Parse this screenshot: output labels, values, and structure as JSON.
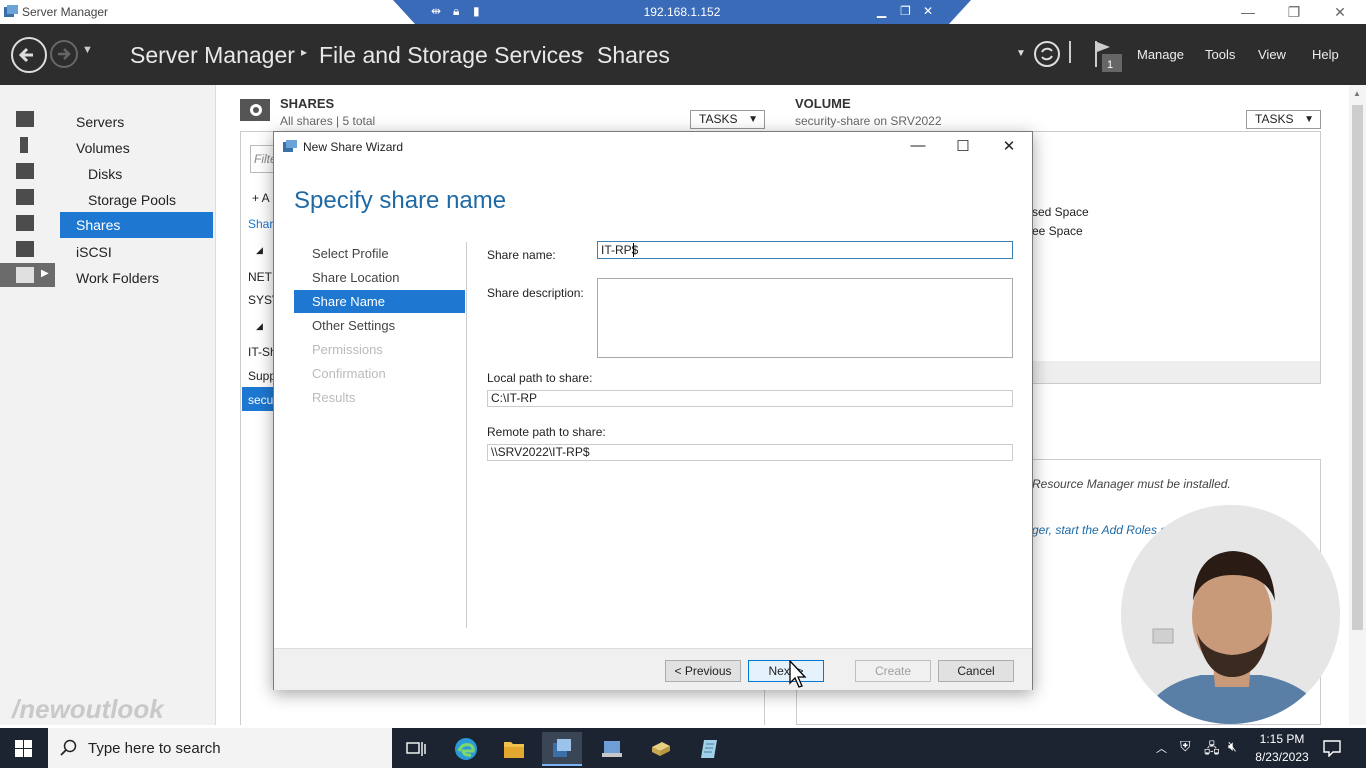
{
  "window": {
    "title": "Server Manager",
    "controls": [
      "—",
      "❐",
      "✕"
    ]
  },
  "rdp": {
    "address": "192.168.1.152"
  },
  "header": {
    "breadcrumb": [
      "Server Manager",
      "File and Storage Services",
      "Shares"
    ],
    "menu": [
      "Manage",
      "Tools",
      "View",
      "Help"
    ],
    "flag_badge": "1"
  },
  "sidebar": {
    "items": [
      {
        "label": "Servers"
      },
      {
        "label": "Volumes"
      },
      {
        "label": "Disks"
      },
      {
        "label": "Storage Pools"
      },
      {
        "label": "Shares"
      },
      {
        "label": "iSCSI"
      },
      {
        "label": "Work Folders"
      }
    ]
  },
  "shares_panel": {
    "title": "SHARES",
    "subtitle": "All shares | 5 total",
    "tasks": "TASKS",
    "filter_placeholder": "Filter",
    "add_text": "+ A",
    "col_fragment": "Share",
    "rows": [
      "NETL",
      "SYSV",
      "IT-Sh",
      "Supp",
      "secu"
    ]
  },
  "volume_panel": {
    "title": "VOLUME",
    "subtitle": "security-share on SRV2022",
    "tasks": "TASKS",
    "used_space": "sed Space",
    "free_space": "ee Space",
    "note1": "Resource Manager must be installed.",
    "note2": "ger, start the Add Roles c"
  },
  "wizard": {
    "title": "New Share Wizard",
    "heading": "Specify share name",
    "steps": [
      {
        "label": "Select Profile",
        "state": "normal"
      },
      {
        "label": "Share Location",
        "state": "normal"
      },
      {
        "label": "Share Name",
        "state": "active"
      },
      {
        "label": "Other Settings",
        "state": "normal"
      },
      {
        "label": "Permissions",
        "state": "disabled"
      },
      {
        "label": "Confirmation",
        "state": "disabled"
      },
      {
        "label": "Results",
        "state": "disabled"
      }
    ],
    "fields": {
      "share_name_label": "Share name:",
      "share_name_value": "IT-RP$",
      "share_description_label": "Share description:",
      "share_description_value": "",
      "local_path_label": "Local path to share:",
      "local_path_value": "C:\\IT-RP",
      "remote_path_label": "Remote path to share:",
      "remote_path_value": "\\\\SRV2022\\IT-RP$"
    },
    "buttons": {
      "previous": "< Previous",
      "next": "Next >",
      "create": "Create",
      "cancel": "Cancel"
    }
  },
  "watermark": "/newoutlook",
  "taskbar": {
    "search_text": "Type here to search",
    "time": "1:15 PM",
    "date": "8/23/2023"
  },
  "colors": {
    "accent": "#1e78d2",
    "header_bg": "#2d2d2d",
    "wizard_heading": "#1f6aa5",
    "taskbar_bg": "#1b2430"
  }
}
